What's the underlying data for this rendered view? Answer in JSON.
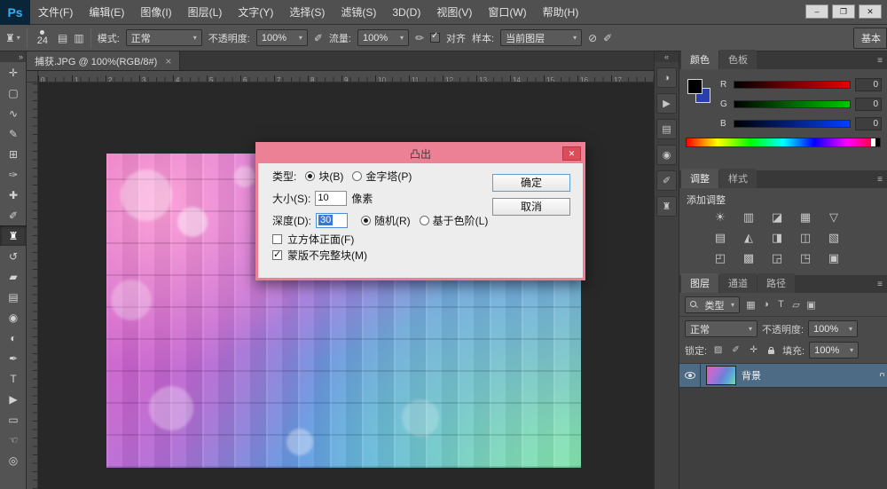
{
  "colors": {
    "dialog_pink": "#ec8094",
    "dialog_close_red": "#de4b59",
    "logo_blue": "#35aef5",
    "layer_selected": "#4e6b85",
    "text_selection_blue": "#3579d8"
  },
  "menu_bar": {
    "logo": "Ps",
    "items": [
      {
        "name": "menu-file",
        "label": "文件(F)"
      },
      {
        "name": "menu-edit",
        "label": "编辑(E)"
      },
      {
        "name": "menu-image",
        "label": "图像(I)"
      },
      {
        "name": "menu-layer",
        "label": "图层(L)"
      },
      {
        "name": "menu-type",
        "label": "文字(Y)"
      },
      {
        "name": "menu-select",
        "label": "选择(S)"
      },
      {
        "name": "menu-filter",
        "label": "滤镜(S)"
      },
      {
        "name": "menu-3d",
        "label": "3D(D)"
      },
      {
        "name": "menu-view",
        "label": "视图(V)"
      },
      {
        "name": "menu-window",
        "label": "窗口(W)"
      },
      {
        "name": "menu-help",
        "label": "帮助(H)"
      }
    ],
    "window_controls": {
      "minimize": "–",
      "restore": "❐",
      "close": "✕"
    }
  },
  "options_bar": {
    "tool_glyph": "♜",
    "brush_size": "24",
    "mode_label": "模式:",
    "mode_value": "正常",
    "opacity_label": "不透明度:",
    "opacity_value": "100%",
    "flow_label": "流量:",
    "flow_value": "100%",
    "align_label": "对齐",
    "sample_label": "样本:",
    "sample_value": "当前图层",
    "workspace_label": "基本"
  },
  "document": {
    "tab_title": "捕获.JPG @ 100%(RGB/8#)",
    "tab_close": "×",
    "ruler_numbers": [
      "0",
      "1",
      "2",
      "3",
      "4",
      "5",
      "6",
      "7",
      "8",
      "9",
      "10",
      "11",
      "12",
      "13",
      "14",
      "15",
      "16",
      "17"
    ]
  },
  "toolbar": {
    "collapse_glyph": "»",
    "tools": [
      {
        "name": "move-tool",
        "glyph": "✛"
      },
      {
        "name": "marquee-tool",
        "glyph": "▢"
      },
      {
        "name": "lasso-tool",
        "glyph": "∿"
      },
      {
        "name": "quick-selection-tool",
        "glyph": "✎"
      },
      {
        "name": "crop-tool",
        "glyph": "⊞"
      },
      {
        "name": "eyedropper-tool",
        "glyph": "✑"
      },
      {
        "name": "healing-brush-tool",
        "glyph": "✚"
      },
      {
        "name": "brush-tool",
        "glyph": "✐"
      },
      {
        "name": "clone-stamp-tool",
        "glyph": "♜",
        "active": true
      },
      {
        "name": "history-brush-tool",
        "glyph": "↺"
      },
      {
        "name": "eraser-tool",
        "glyph": "▰"
      },
      {
        "name": "gradient-tool",
        "glyph": "▤"
      },
      {
        "name": "blur-tool",
        "glyph": "◉"
      },
      {
        "name": "dodge-tool",
        "glyph": "◐"
      },
      {
        "name": "pen-tool",
        "glyph": "✒"
      },
      {
        "name": "type-tool",
        "glyph": "T"
      },
      {
        "name": "path-selection-tool",
        "glyph": "▶"
      },
      {
        "name": "shape-tool",
        "glyph": "▭"
      },
      {
        "name": "hand-tool",
        "glyph": "☜"
      },
      {
        "name": "zoom-tool",
        "glyph": "◎"
      }
    ]
  },
  "panel_strip": {
    "collapse_glyph": "«",
    "icons": [
      {
        "name": "adjustments-panel-icon",
        "glyph": "◑"
      },
      {
        "name": "actions-panel-icon",
        "glyph": "▶"
      },
      {
        "name": "properties-panel-icon",
        "glyph": "▤"
      },
      {
        "name": "info-panel-icon",
        "glyph": "◉"
      },
      {
        "name": "brush-panel-icon",
        "glyph": "✐"
      },
      {
        "name": "clone-source-panel-icon",
        "glyph": "♜"
      }
    ]
  },
  "dialog": {
    "title": "凸出",
    "close_glyph": "✕",
    "type_label": "类型:",
    "type_block": "块(B)",
    "type_pyramid": "金字塔(P)",
    "size_label": "大小(S):",
    "size_value": "10",
    "size_unit": "像素",
    "depth_label": "深度(D):",
    "depth_value": "30",
    "depth_random": "随机(R)",
    "depth_levels": "基于色阶(L)",
    "option_front": "立方体正面(F)",
    "option_mask": "蒙版不完整块(M)",
    "ok_label": "确定",
    "cancel_label": "取消"
  },
  "color_panel": {
    "tab_color": "颜色",
    "tab_swatches": "色板",
    "menu_glyph": "≡",
    "channels": [
      {
        "name": "red-channel",
        "label": "R",
        "value": "0"
      },
      {
        "name": "green-channel",
        "label": "G",
        "value": "0"
      },
      {
        "name": "blue-channel",
        "label": "B",
        "value": "0"
      }
    ]
  },
  "adjustments_panel": {
    "tab_adjustments": "调整",
    "tab_styles": "样式",
    "menu_glyph": "≡",
    "add_label": "添加调整",
    "icons": [
      {
        "name": "brightness-contrast-icon",
        "glyph": "☀"
      },
      {
        "name": "levels-icon",
        "glyph": "▥"
      },
      {
        "name": "curves-icon",
        "glyph": "◪"
      },
      {
        "name": "exposure-icon",
        "glyph": "▦"
      },
      {
        "name": "vibrance-icon",
        "glyph": "▽"
      },
      {
        "name": "hue-saturation-icon",
        "glyph": "▤"
      },
      {
        "name": "color-balance-icon",
        "glyph": "◭"
      },
      {
        "name": "black-white-icon",
        "glyph": "◨"
      },
      {
        "name": "photo-filter-icon",
        "glyph": "◫"
      },
      {
        "name": "channel-mixer-icon",
        "glyph": "▧"
      },
      {
        "name": "invert-icon",
        "glyph": "◰"
      },
      {
        "name": "posterize-icon",
        "glyph": "▩"
      },
      {
        "name": "threshold-icon",
        "glyph": "◲"
      },
      {
        "name": "gradient-map-icon",
        "glyph": "◳"
      },
      {
        "name": "selective-color-icon",
        "glyph": "▣"
      }
    ]
  },
  "layers_panel": {
    "tab_layers": "图层",
    "tab_channels": "通道",
    "tab_paths": "路径",
    "menu_glyph": "≡",
    "filter_label": "类型",
    "filter_icons": [
      {
        "name": "filter-pixel-layers-icon",
        "glyph": "▦"
      },
      {
        "name": "filter-adjustment-layers-icon",
        "glyph": "◑"
      },
      {
        "name": "filter-type-layers-icon",
        "glyph": "T"
      },
      {
        "name": "filter-shape-layers-icon",
        "glyph": "▱"
      },
      {
        "name": "filter-smart-objects-icon",
        "glyph": "▣"
      }
    ],
    "blend_mode": "正常",
    "opacity_label": "不透明度:",
    "opacity_value": "100%",
    "lock_label": "锁定:",
    "fill_label": "填充:",
    "fill_value": "100%",
    "layers": [
      {
        "name": "背景",
        "selected": true,
        "locked": true,
        "visible": true
      }
    ]
  }
}
